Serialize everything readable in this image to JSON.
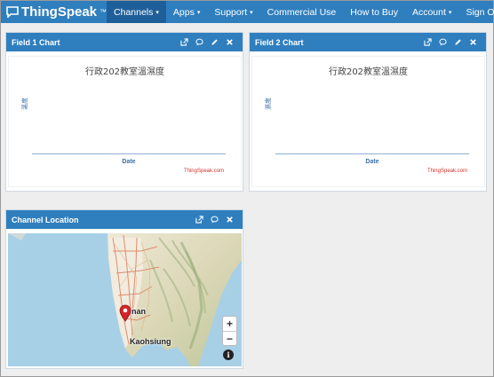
{
  "navbar": {
    "brand": "ThingSpeak",
    "brand_tm": "™",
    "items": [
      {
        "label": "Channels",
        "caret": "▾"
      },
      {
        "label": "Apps",
        "caret": "▾"
      },
      {
        "label": "Support",
        "caret": "▾"
      }
    ],
    "right_items": [
      {
        "label": "Commercial Use"
      },
      {
        "label": "How to Buy"
      },
      {
        "label": "Account",
        "caret": "▾"
      },
      {
        "label": "Sign Out"
      }
    ]
  },
  "field1": {
    "title": "Field 1 Chart",
    "chart_title": "行政202教室溫濕度",
    "ylabel": "溫度",
    "xlabel": "Date",
    "credit": "ThingSpeak.com"
  },
  "field2": {
    "title": "Field 2 Chart",
    "chart_title": "行政202教室溫濕度",
    "ylabel": "濕度",
    "xlabel": "Date",
    "credit": "ThingSpeak.com"
  },
  "location": {
    "title": "Channel Location",
    "city_1": "nan",
    "city_2": "Kaohsiung",
    "zoom_in": "+",
    "zoom_out": "−",
    "info": "i"
  },
  "colors": {
    "primary": "#2f7fbf",
    "primary_dark": "#1f5f99",
    "credit": "#d0312d"
  }
}
